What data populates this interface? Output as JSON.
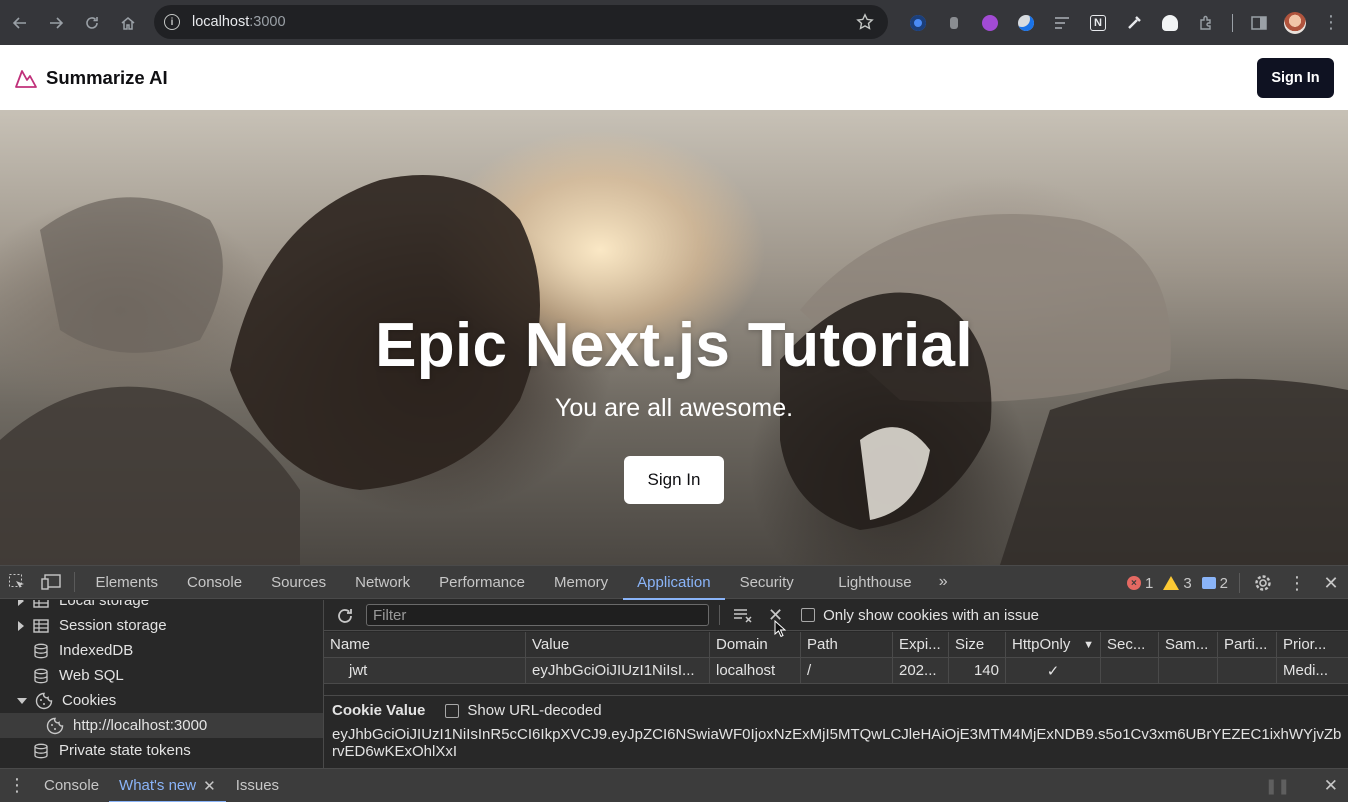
{
  "browser": {
    "url_host": "localhost",
    "url_port": ":3000",
    "extensions": [
      "extension-blue-circle",
      "extension-gray",
      "extension-purple",
      "extension-globe",
      "extension-lines",
      "extension-notion",
      "extension-eyedropper",
      "extension-ghost",
      "extensions-puzzle"
    ]
  },
  "site": {
    "brand": "Summarize AI",
    "header_signin": "Sign In",
    "hero_title": "Epic Next.js Tutorial",
    "hero_subtitle": "You are all awesome.",
    "hero_button": "Sign In"
  },
  "devtools": {
    "tabs": [
      "Elements",
      "Console",
      "Sources",
      "Network",
      "Performance",
      "Memory",
      "Application",
      "Security",
      "Lighthouse"
    ],
    "active_tab": "Application",
    "errors": "1",
    "warnings": "3",
    "messages": "2",
    "sidebar": [
      {
        "label": "Local storage",
        "icon": "grid-icon",
        "expand": "right"
      },
      {
        "label": "Session storage",
        "icon": "grid-icon",
        "expand": "right"
      },
      {
        "label": "IndexedDB",
        "icon": "database-icon",
        "expand": ""
      },
      {
        "label": "Web SQL",
        "icon": "database-icon",
        "expand": ""
      },
      {
        "label": "Cookies",
        "icon": "cookie-icon",
        "expand": "down"
      },
      {
        "label": "http://localhost:3000",
        "icon": "cookie-icon",
        "expand": "",
        "selected": true
      },
      {
        "label": "Private state tokens",
        "icon": "database-icon",
        "expand": ""
      }
    ],
    "filter_placeholder": "Filter",
    "only_issue_label": "Only show cookies with an issue",
    "columns": [
      "Name",
      "Value",
      "Domain",
      "Path",
      "Expi...",
      "Size",
      "HttpOnly",
      "Sec...",
      "Sam...",
      "Parti...",
      "Prior..."
    ],
    "rows": [
      [
        "jwt",
        "eyJhbGciOiJIUzI1NiIsI...",
        "localhost",
        "/",
        "202...",
        "140",
        "✓",
        "",
        "",
        "",
        "Medi..."
      ]
    ],
    "cookie_value_label": "Cookie Value",
    "show_decoded_label": "Show URL-decoded",
    "cookie_value": "eyJhbGciOiJIUzI1NiIsInR5cCI6IkpXVCJ9.eyJpZCI6NSwiaWF0IjoxNzExMjI5MTQwLCJleHAiOjE3MTM4MjExNDB9.s5o1Cv3xm6UBrYEZEC1ixhWYjvZbrvED6wKExOhlXxI",
    "drawer_tabs": [
      "Console",
      "What's new",
      "Issues"
    ]
  }
}
